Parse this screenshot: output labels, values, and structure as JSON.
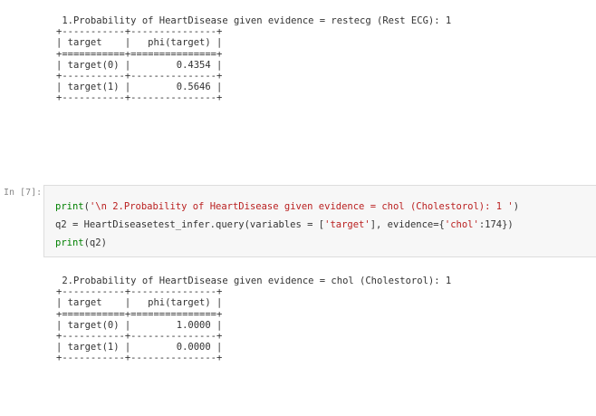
{
  "output1": {
    "title": " 1.Probability of HeartDisease given evidence = restecg (Rest ECG): 1",
    "table": [
      "+-----------+---------------+",
      "| target    |   phi(target) |",
      "+===========+===============+",
      "| target(0) |        0.4354 |",
      "+-----------+---------------+",
      "| target(1) |        0.5646 |",
      "+-----------+---------------+"
    ]
  },
  "cell": {
    "prompt": "In [7]:",
    "line1": {
      "fn": "print",
      "open": "(",
      "str": "'\\n 2.Probability of HeartDisease given evidence = chol (Cholestorol): 1 '",
      "close": ")"
    },
    "line2": {
      "pre": "q2 = HeartDiseasetest_infer.query(variables = [",
      "str1": "'target'",
      "mid": "], evidence={",
      "str2": "'chol'",
      "post": ":174})"
    },
    "line3": {
      "fn": "print",
      "rest": "(q2)"
    }
  },
  "output2": {
    "title": " 2.Probability of HeartDisease given evidence = chol (Cholestorol): 1",
    "table": [
      "+-----------+---------------+",
      "| target    |   phi(target) |",
      "+===========+===============+",
      "| target(0) |        1.0000 |",
      "+-----------+---------------+",
      "| target(1) |        0.0000 |",
      "+-----------+---------------+"
    ]
  }
}
